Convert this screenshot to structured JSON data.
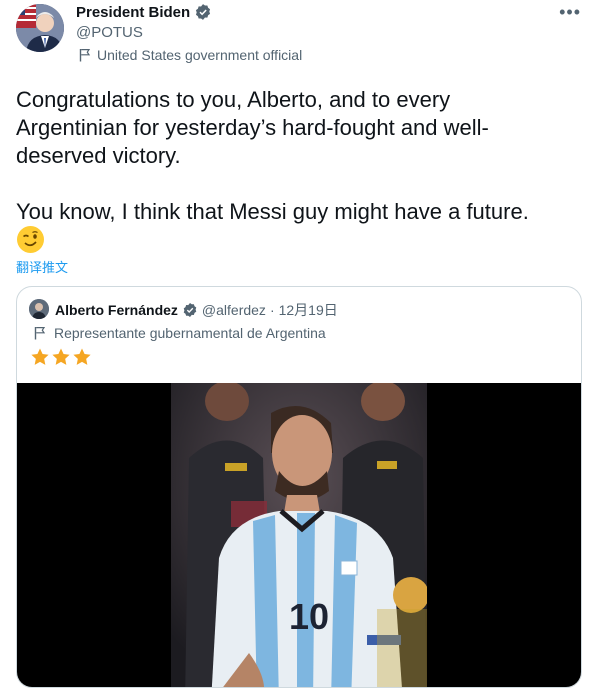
{
  "author": {
    "name": "President Biden",
    "handle": "@POTUS",
    "label": "United States government official",
    "avatar_icon": "avatar-flag-portrait",
    "verified_icon": "verified-badge-icon"
  },
  "tweet": {
    "text": "Congratulations to you, Alberto, and to every\nArgentinian for yesterday’s hard-fought and well-\ndeserved victory.\n\nYou know, I think that Messi guy might have a future.",
    "emoji": "winking-face-emoji",
    "translate_label": "翻译推文"
  },
  "quote": {
    "name": "Alberto Fernández",
    "handle": "@alferdez",
    "separator": "·",
    "date": "12月19日",
    "label": "Representante gubernamental de Argentina",
    "stars": [
      "★",
      "★",
      "★"
    ],
    "media": "video-still-messi-argentina-jersey"
  },
  "colors": {
    "text": "#0f1419",
    "secondary": "#536471",
    "accent": "#1d9bf0",
    "border": "#cfd9de",
    "star": "#f5a623"
  }
}
